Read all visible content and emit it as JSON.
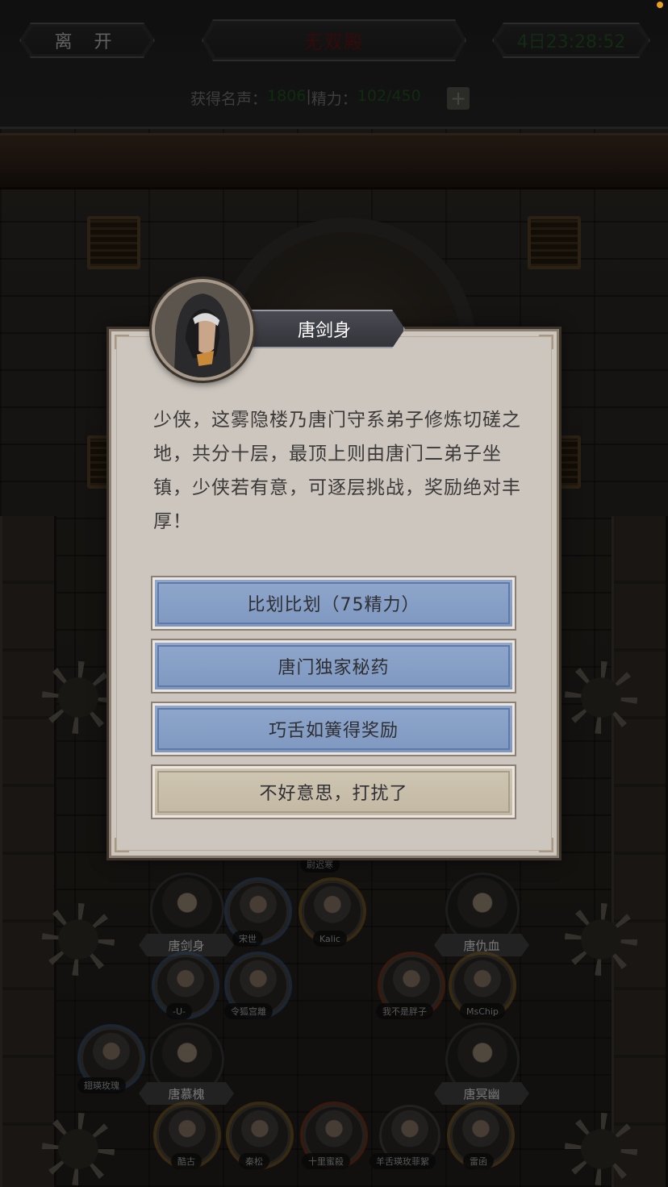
{
  "header": {
    "leave_label": "离 开",
    "hall_title": "无双殿",
    "timer": "4日23:28:52",
    "fame_label": "获得名声：",
    "fame_value": "1806",
    "separator": " | ",
    "energy_label": "精力：",
    "energy_value": "102/450",
    "plus_icon": "plus-icon"
  },
  "dialog": {
    "npc_name": "唐剑身",
    "npc_avatar_icon": "hooded-assassin-portrait",
    "text": "少侠，这雾隐楼乃唐门守系弟子修炼切磋之地，共分十层，最顶上则由唐门二弟子坐镇，少侠若有意，可逐层挑战，奖励绝对丰厚！",
    "options": [
      {
        "label": "比划比划（75精力）"
      },
      {
        "label": "唐门独家秘药"
      },
      {
        "label": "巧舌如簧得奖励"
      },
      {
        "label": "不好意思，打扰了"
      }
    ]
  },
  "roster": {
    "top_tag": "尉迟寒",
    "row1": [
      {
        "name": "唐剑身"
      },
      {
        "name": "宋世"
      },
      {
        "name": "Kalic"
      },
      {
        "name": "唐仇血"
      }
    ],
    "row2": [
      {
        "name": "-U-"
      },
      {
        "name": "令狐宫離"
      },
      {
        "name": "我不是胖子"
      },
      {
        "name": "MsChip"
      }
    ],
    "row3": [
      {
        "name": "翅瑛玫瑰"
      },
      {
        "name": "唐慕槐"
      },
      {
        "name": "唐冥幽"
      }
    ],
    "row4": [
      {
        "name": "酷古"
      },
      {
        "name": "秦松"
      },
      {
        "name": "十里蜜殺"
      },
      {
        "name": "羊舌瑛玫菲絮"
      },
      {
        "name": "雷函"
      }
    ]
  },
  "colors": {
    "accent_blue": "#8fa7cc",
    "dialog_bg": "#cdc6bf",
    "title_red": "#5a1212",
    "timer_green": "#1f4a1f"
  }
}
